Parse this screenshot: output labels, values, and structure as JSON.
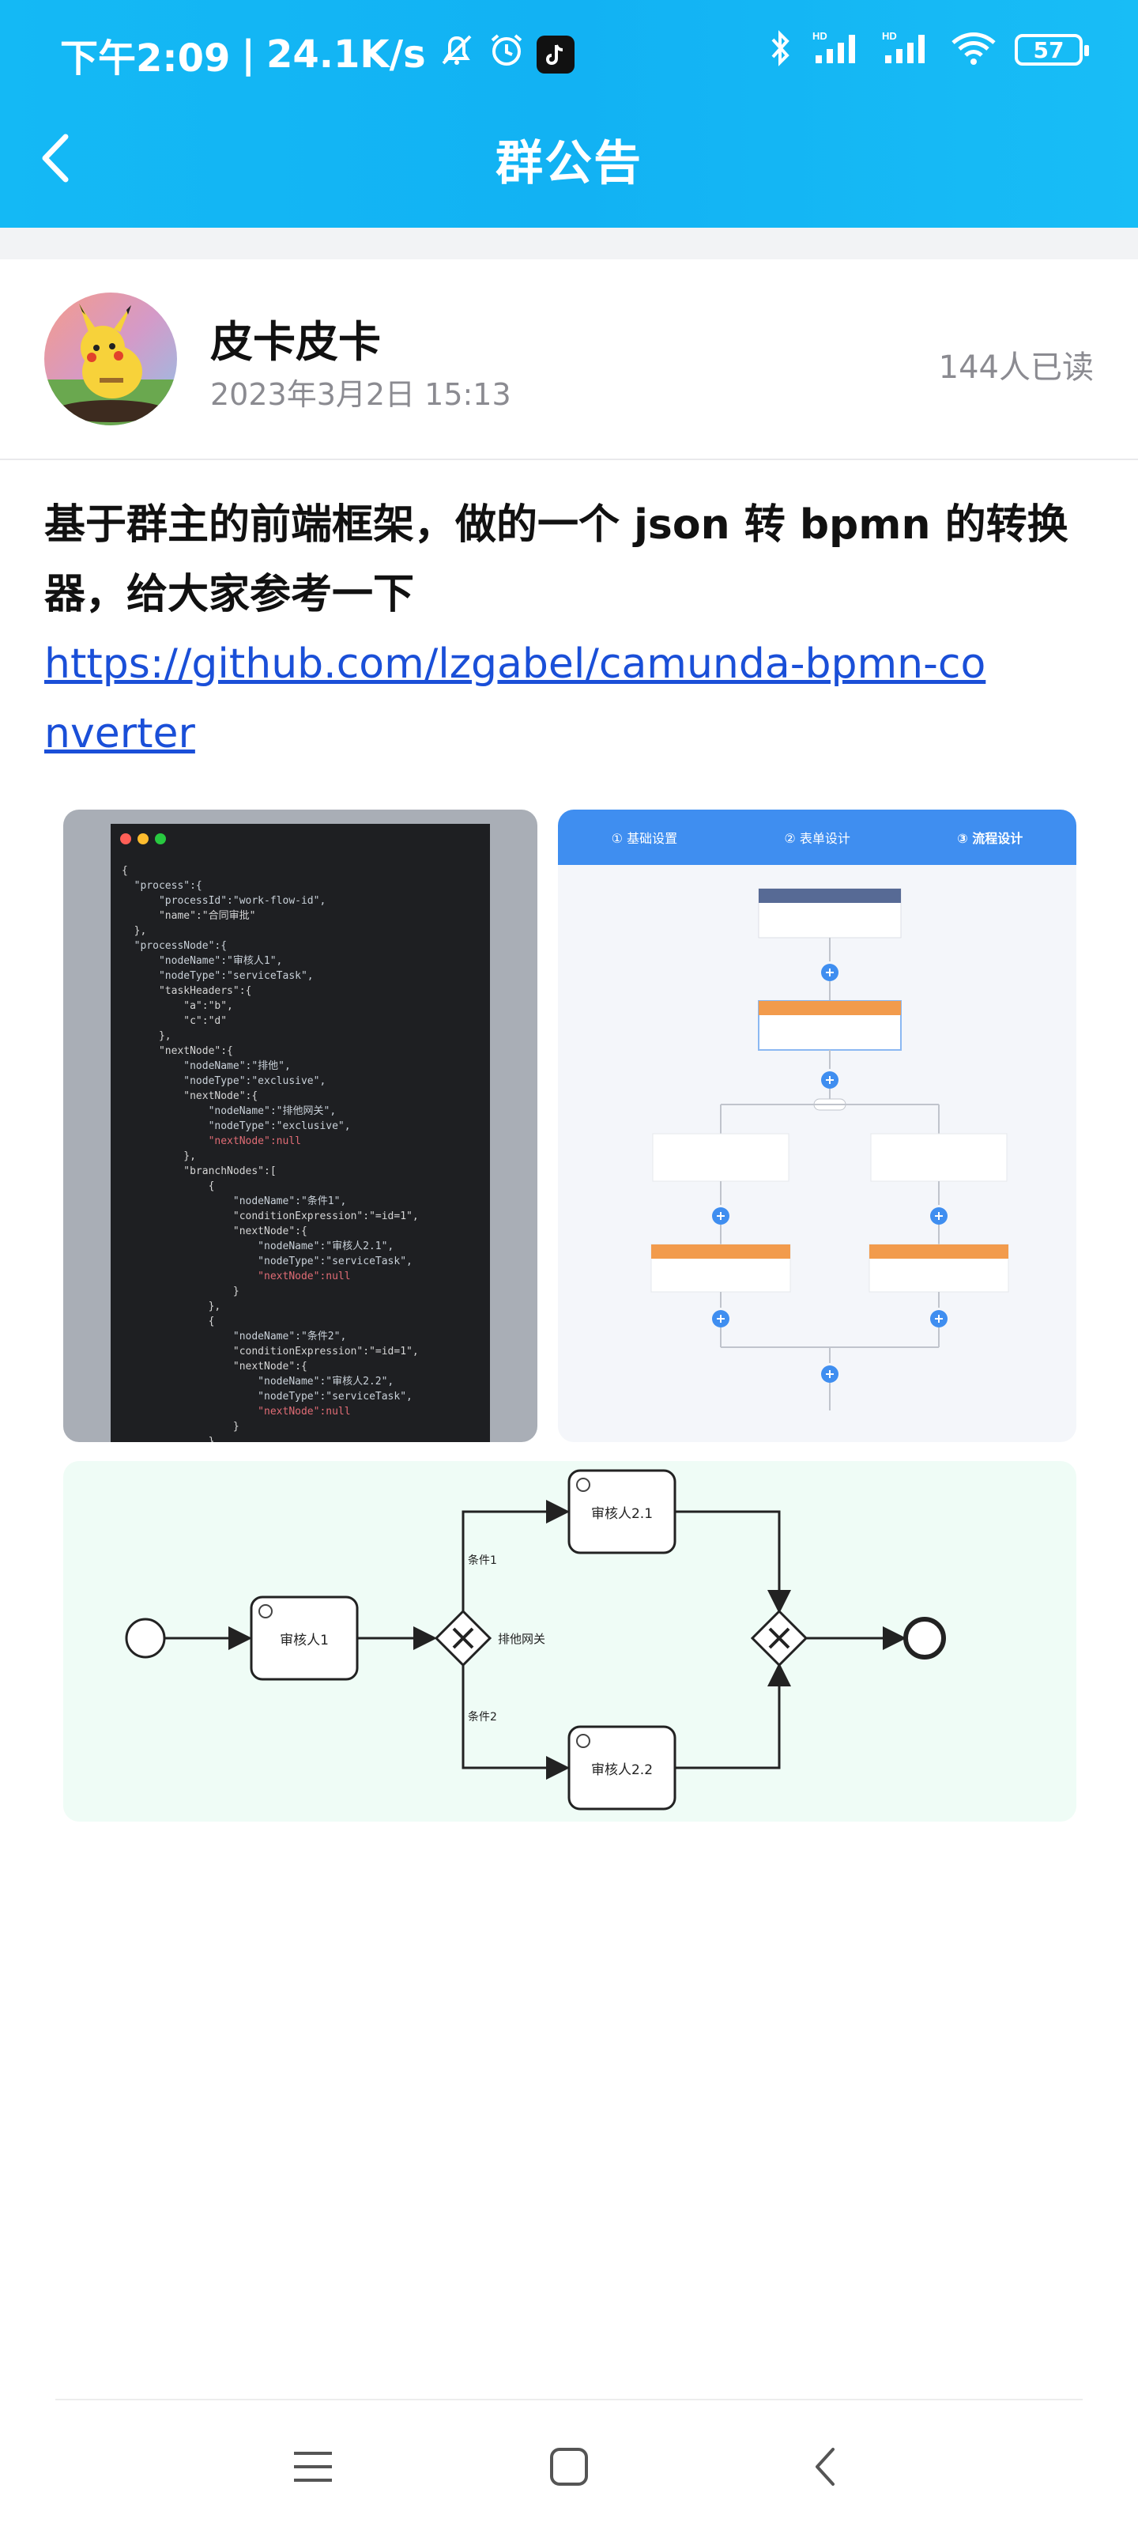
{
  "status_bar": {
    "time": "下午2:09",
    "net_speed": "24.1K/s",
    "battery": "57",
    "hd1": "HD",
    "hd2": "HD"
  },
  "nav": {
    "title": "群公告",
    "back_icon": "chevron-left-icon"
  },
  "author": {
    "name": "皮卡皮卡",
    "time": "2023年3月2日 15:13",
    "read_count": "144人已读"
  },
  "post": {
    "text": "基于群主的前端框架，做的一个 json 转 bpmn 的转换器，给大家参考一下",
    "link": "https://github.com/lzgabel/camunda-bpmn-converter"
  },
  "images": {
    "flow_tabs": [
      "① 基础设置",
      "② 表单设计",
      "③ 流程设计"
    ],
    "bpmn": {
      "task1": "审核人1",
      "task21": "审核人2.1",
      "task22": "审核人2.2",
      "gateway": "排他网关",
      "cond1": "条件1",
      "cond2": "条件2"
    },
    "code_lines": [
      "{",
      "  \"process\":{",
      "      \"processId\":\"work-flow-id\",",
      "      \"name\":\"合同审批\"",
      "  },",
      "  \"processNode\":{",
      "      \"nodeName\":\"审核人1\",",
      "      \"nodeType\":\"serviceTask\",",
      "      \"taskHeaders\":{",
      "          \"a\":\"b\",",
      "          \"c\":\"d\"",
      "      },",
      "      \"nextNode\":{",
      "          \"nodeName\":\"排他\",",
      "          \"nodeType\":\"exclusive\",",
      "          \"nextNode\":{",
      "              \"nodeName\":\"排他网关\",",
      "              \"nodeType\":\"exclusive\",",
      "              \"nextNode\":null",
      "          },",
      "          \"branchNodes\":[",
      "              {",
      "                  \"nodeName\":\"条件1\",",
      "                  \"conditionExpression\":\"=id=1\",",
      "                  \"nextNode\":{",
      "                      \"nodeName\":\"审核人2.1\",",
      "                      \"nodeType\":\"serviceTask\",",
      "                      \"nextNode\":null",
      "                  }",
      "              },",
      "              {",
      "                  \"nodeName\":\"条件2\",",
      "                  \"conditionExpression\":\"=id=1\",",
      "                  \"nextNode\":{",
      "                      \"nodeName\":\"审核人2.2\",",
      "                      \"nodeType\":\"serviceTask\",",
      "                      \"nextNode\":null",
      "                  }",
      "              }"
    ]
  },
  "bottom_nav": {
    "menu_icon": "menu-icon",
    "home_icon": "home-square-icon",
    "back_icon": "back-triangle-icon"
  },
  "colors": {
    "header": "#14b9f5",
    "link": "#1a4fd8",
    "muted": "#8b8b91"
  }
}
